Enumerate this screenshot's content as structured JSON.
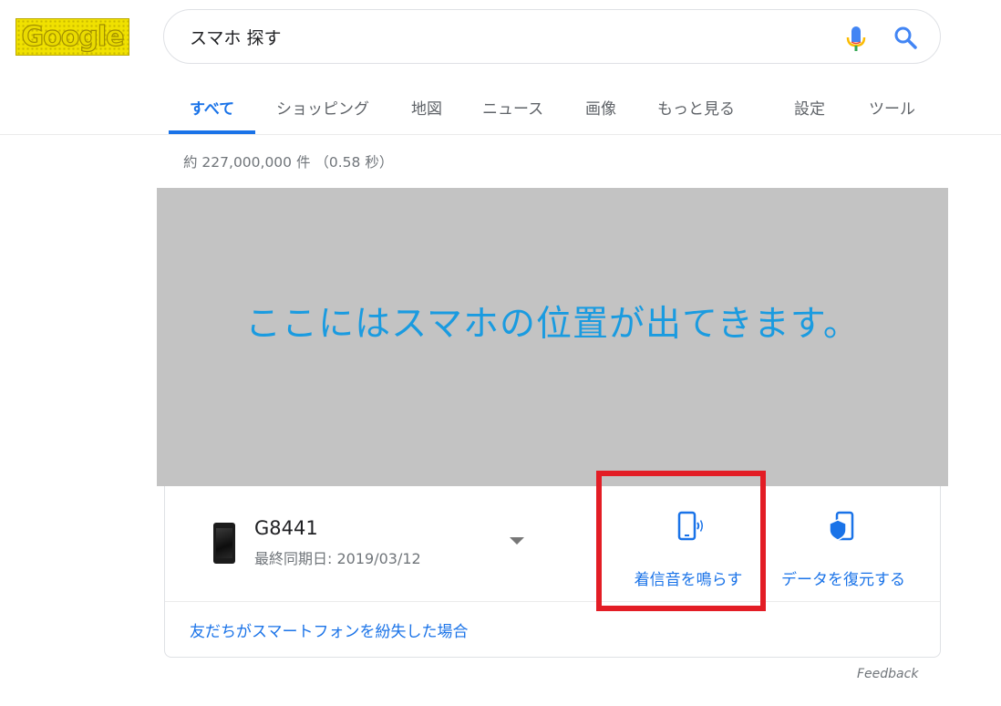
{
  "logo": {
    "text": "Google"
  },
  "search": {
    "query": "スマホ 探す"
  },
  "tabs": [
    {
      "label": "すべて",
      "active": true
    },
    {
      "label": "ショッピング"
    },
    {
      "label": "地図"
    },
    {
      "label": "ニュース"
    },
    {
      "label": "画像"
    },
    {
      "label": "もっと見る"
    },
    {
      "label": "設定"
    },
    {
      "label": "ツール"
    }
  ],
  "result_stats": "約 227,000,000 件 （0.58 秒）",
  "map_placeholder": "ここにはスマホの位置が出てきます。",
  "device": {
    "name": "G8441",
    "last_sync": "最終同期日: 2019/03/12"
  },
  "actions": {
    "ring": "着信音を鳴らす",
    "restore": "データを復元する"
  },
  "friend_link": "友だちがスマートフォンを紛失した場合",
  "feedback": "Feedback",
  "colors": {
    "accent": "#1a73e8",
    "highlight": "#e31d25",
    "map_bg": "#c3c3c3"
  },
  "icons": [
    "mic-icon",
    "search-icon",
    "ring-phone-icon",
    "restore-data-icon",
    "dropdown-arrow-icon"
  ]
}
